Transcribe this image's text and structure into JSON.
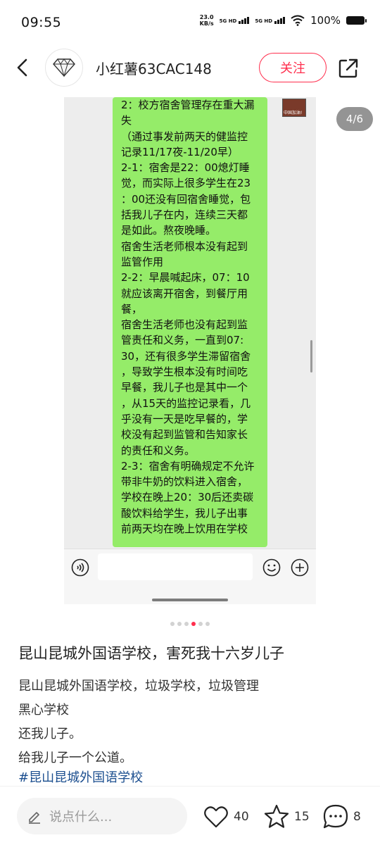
{
  "status_bar": {
    "time": "09:55",
    "net_speed_value": "23.0",
    "net_speed_unit": "KB/s",
    "signal1_label": "5G HD",
    "signal2_label": "5G HD",
    "battery": "100%"
  },
  "header": {
    "username": "小红薯63CAC148",
    "follow_label": "关注",
    "avatar_icon": "diamond-icon"
  },
  "image": {
    "page_indicator": "4/6",
    "current_page": 4,
    "total_pages": 6,
    "thumb_caption": "中国加油!",
    "chat_lines": [
      "2：校方宿舍管理存在重大漏",
      "失",
      " （通过事发前两天的健监控",
      "记录11/17夜-11/20早）",
      "2-1：宿舍是22：00熄灯睡",
      "觉，而实际上很多学生在23",
      "：00还没有回宿舍睡觉，包",
      "括我儿子在内，连续三天都",
      "是如此。熬夜晚睡。",
      "宿舍生活老师根本没有起到",
      "监管作用",
      "2-2：早晨喊起床，07：10",
      "就应该离开宿舍，到餐厅用",
      "餐，",
      "宿舍生活老师也没有起到监",
      "管责任和义务，一直到07:",
      "30，还有很多学生滞留宿舍",
      "，导致学生根本没有时间吃",
      "早餐，我儿子也是其中一个",
      "，从15天的监控记录看，几",
      "乎没有一天是吃早餐的，学",
      "校没有起到监管和告知家长",
      "的责任和义务。",
      "2-3：宿舍有明确规定不允许",
      "带非牛奶的饮料进入宿舍，",
      "学校在晚上20：30后还卖碳",
      "酸饮料给学生，我儿子出事",
      "前两天均在晚上饮用在学校"
    ]
  },
  "post": {
    "title": "昆山昆城外国语学校，害死我十六岁儿子",
    "body_lines": [
      "昆山昆城外国语学校，垃圾学校，垃圾管理",
      "黑心学校",
      "还我儿子。",
      "给我儿子一个公道。"
    ],
    "hashtag": "#昆山昆城外国语学校"
  },
  "bottom_bar": {
    "comment_placeholder": "说点什么...",
    "likes": "40",
    "collects": "15",
    "comments": "8"
  },
  "colors": {
    "accent": "#ff2e4d",
    "chat_bubble": "#95ec69",
    "hashtag": "#1b4e8f"
  }
}
